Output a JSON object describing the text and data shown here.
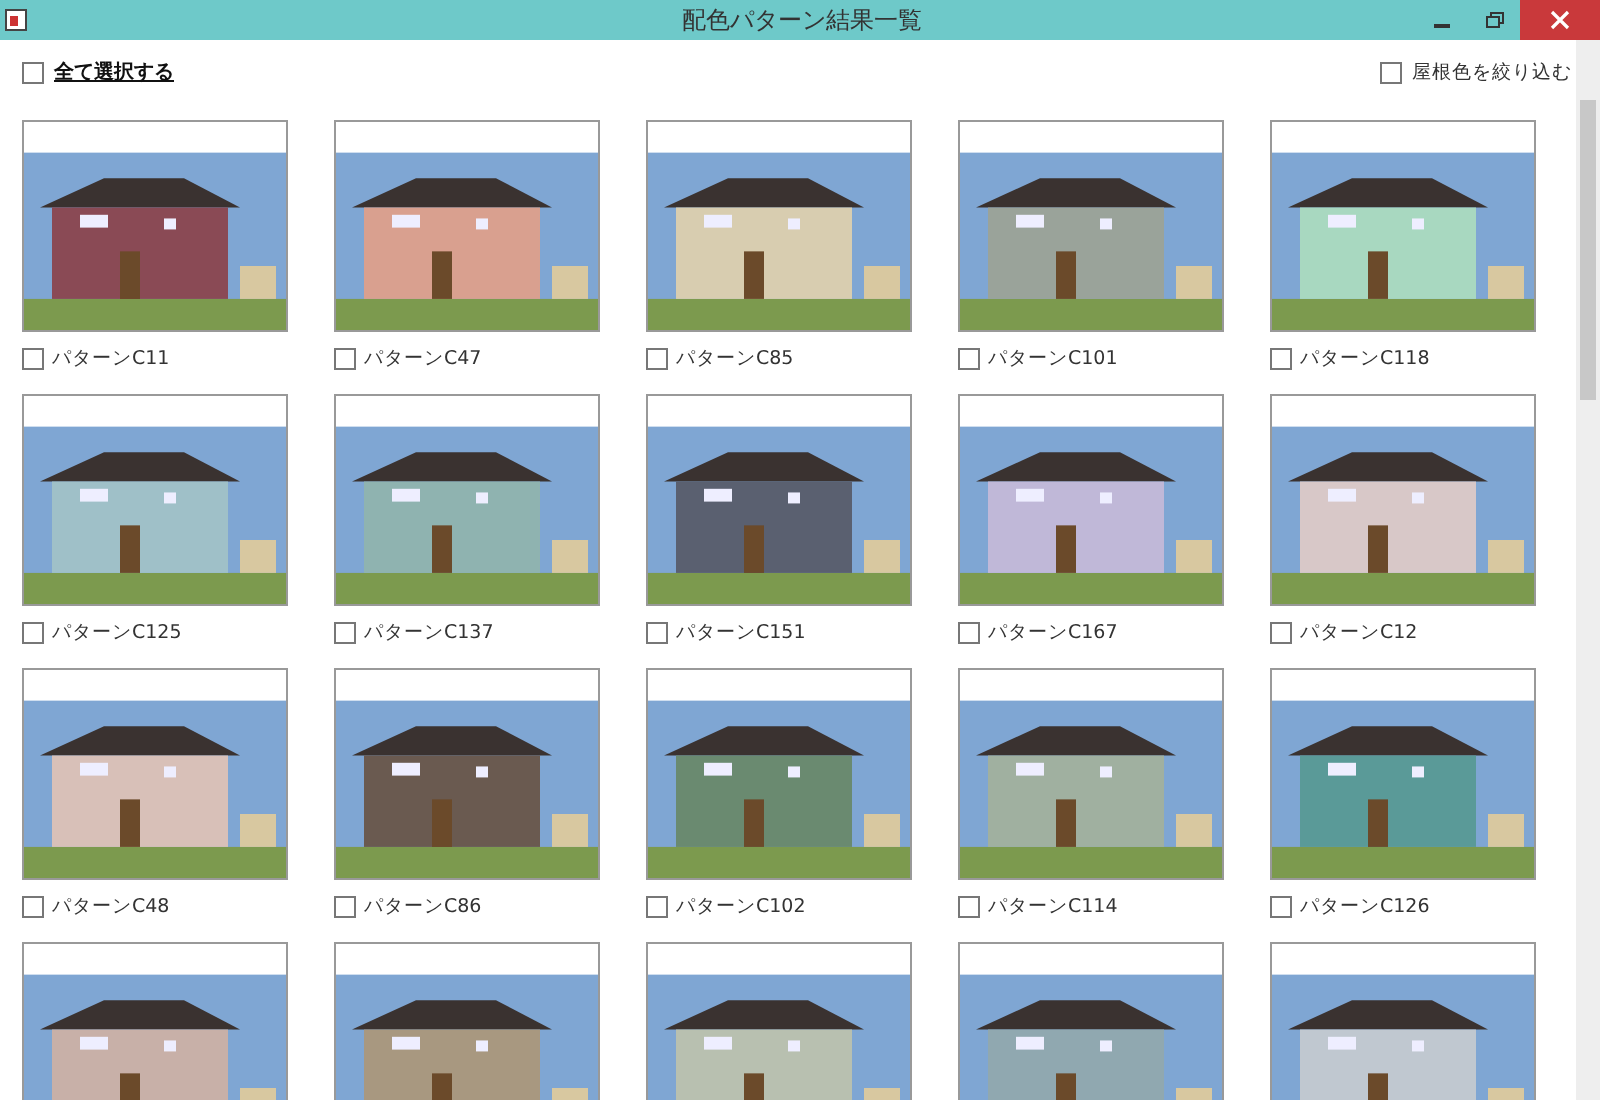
{
  "window": {
    "title": "配色パターン結果一覧"
  },
  "select_all": {
    "label": "全て選択する",
    "checked": false
  },
  "roof_filter": {
    "label": "屋根色を絞り込む",
    "checked": false
  },
  "patterns": [
    {
      "label": "パターンC11",
      "checked": false,
      "color": "#8a4a55"
    },
    {
      "label": "パターンC47",
      "checked": false,
      "color": "#d9a08f"
    },
    {
      "label": "パターンC85",
      "checked": false,
      "color": "#d8cdb0"
    },
    {
      "label": "パターンC101",
      "checked": false,
      "color": "#9aa39a"
    },
    {
      "label": "パターンC118",
      "checked": false,
      "color": "#a8d8c0"
    },
    {
      "label": "パターンC125",
      "checked": false,
      "color": "#9fc0c8"
    },
    {
      "label": "パターンC137",
      "checked": false,
      "color": "#8fb3b0"
    },
    {
      "label": "パターンC151",
      "checked": false,
      "color": "#5a6070"
    },
    {
      "label": "パターンC167",
      "checked": false,
      "color": "#c0b8d8"
    },
    {
      "label": "パターンC12",
      "checked": false,
      "color": "#d8c8c8"
    },
    {
      "label": "パターンC48",
      "checked": false,
      "color": "#d8c0b8"
    },
    {
      "label": "パターンC86",
      "checked": false,
      "color": "#6a5a50"
    },
    {
      "label": "パターンC102",
      "checked": false,
      "color": "#6a8a70"
    },
    {
      "label": "パターンC114",
      "checked": false,
      "color": "#a0b0a0"
    },
    {
      "label": "パターンC126",
      "checked": false,
      "color": "#5a9a98"
    }
  ],
  "cut_off_thumbnails": [
    {
      "color": "#c8b0a8"
    },
    {
      "color": "#a89880"
    },
    {
      "color": "#b8c0b0"
    },
    {
      "color": "#90a8b0"
    },
    {
      "color": "#c0c8d0"
    }
  ]
}
